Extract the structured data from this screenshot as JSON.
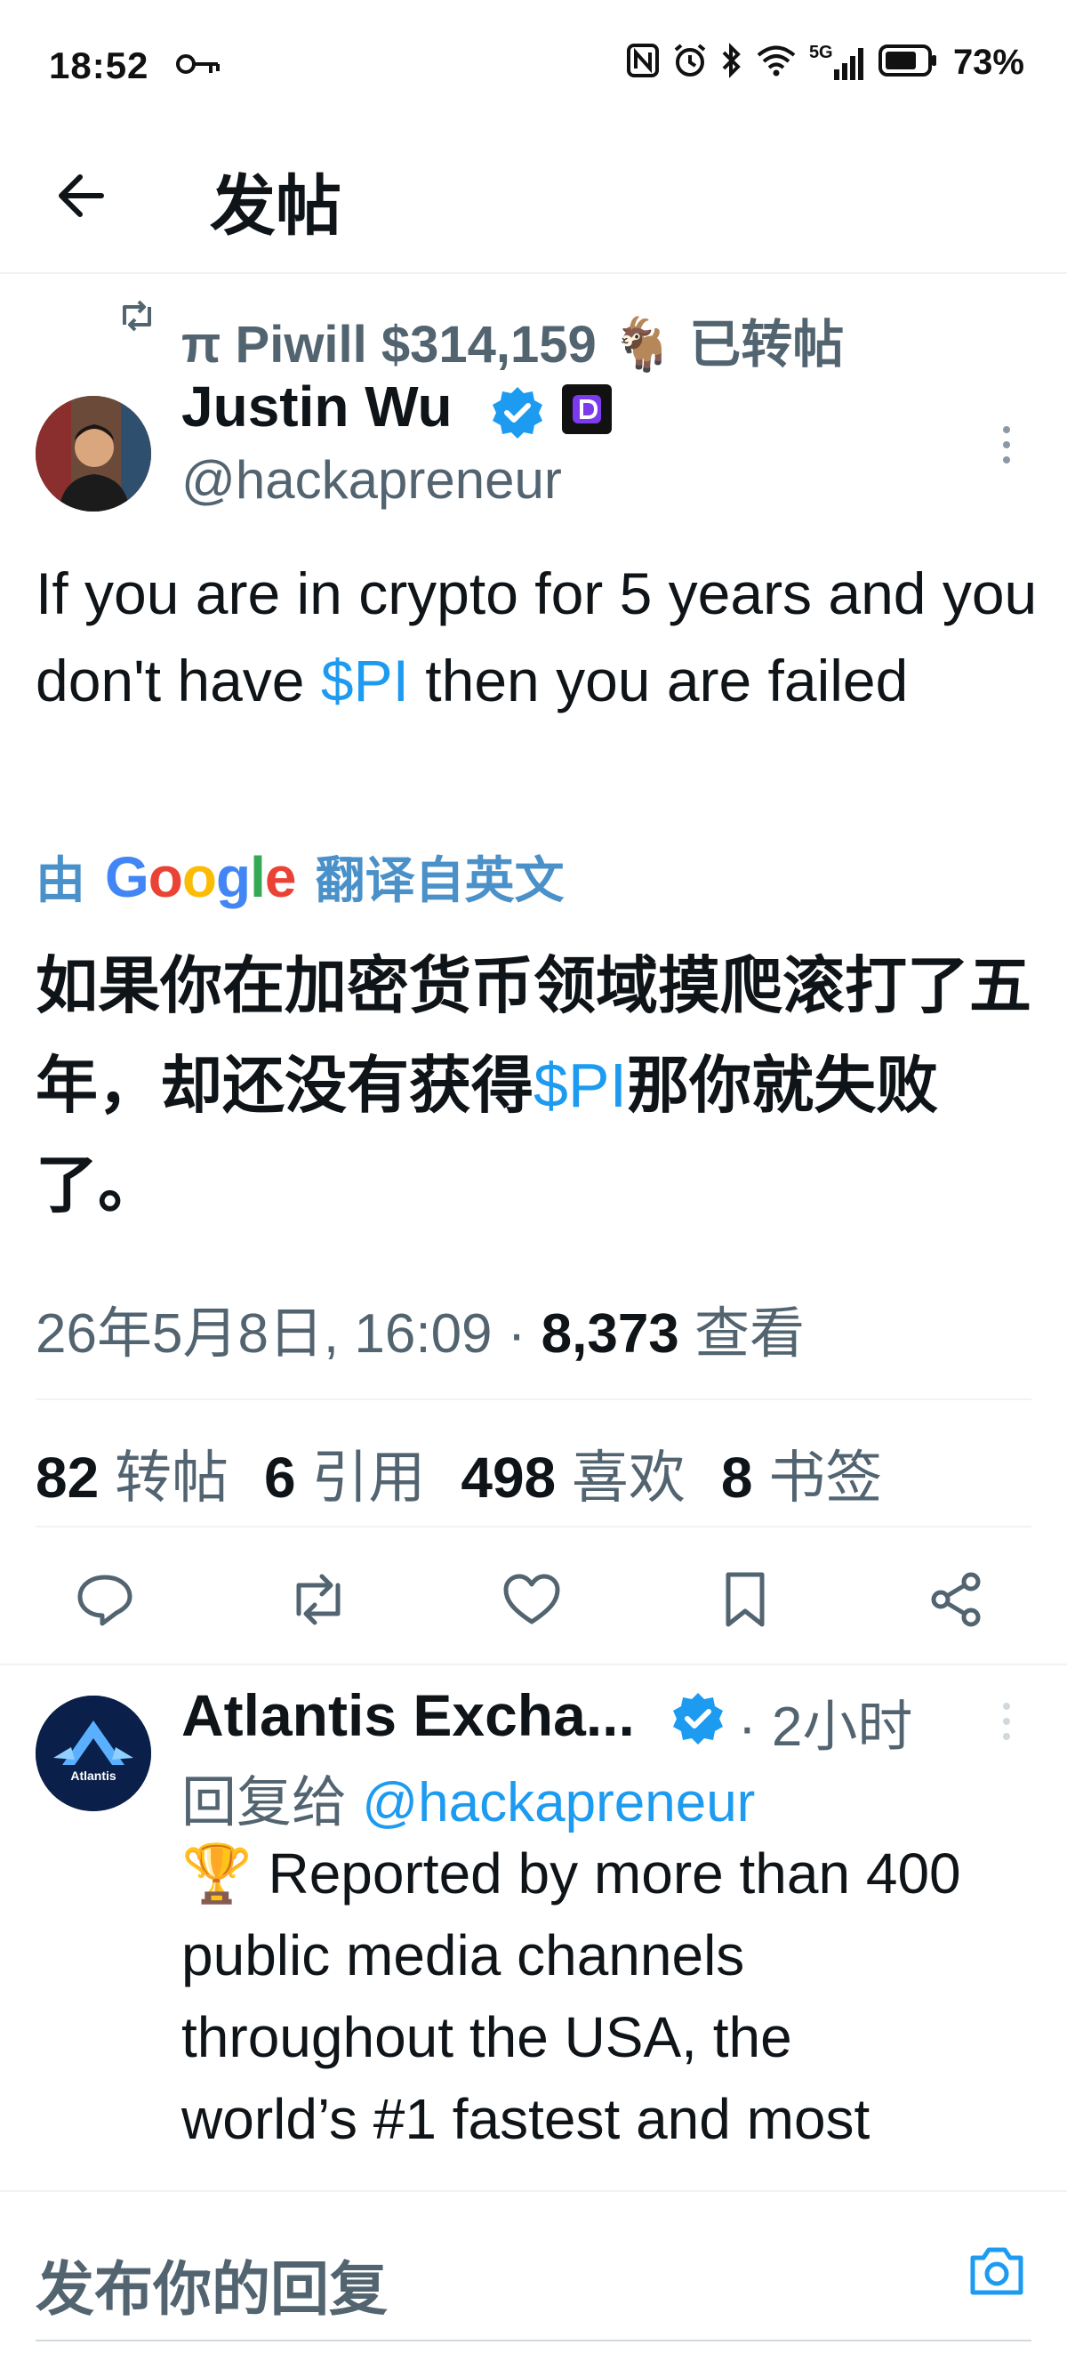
{
  "status_bar": {
    "time": "18:52",
    "battery_pct": "73%",
    "net_label": "5G"
  },
  "header": {
    "title": "发帖"
  },
  "retweet": {
    "text": "π Piwill $314,159 🐐 已转帖"
  },
  "tweet": {
    "author_name": "Justin Wu",
    "handle": "@hackapreneur",
    "text_part1": "If you are in crypto for 5 years and you don't have ",
    "cashtag": "$PI",
    "text_part2": " then you are failed",
    "translate_prefix": "由",
    "translate_brand": "Google",
    "translate_suffix": "翻译自英文",
    "translated_part1": "如果你在加密货币领域摸爬滚打了五年，却还没有获得",
    "translated_cashtag": "$PI",
    "translated_part2": "那你就失败了。",
    "timestamp": "26年5月8日, 16:09 · ",
    "views_count": "8,373",
    "views_label": " 查看"
  },
  "stats": {
    "reposts_count": "82",
    "reposts_label": " 转帖",
    "quotes_count": "6",
    "quotes_label": "引用",
    "likes_count": "498",
    "likes_label": " 喜欢",
    "bookmarks_count": "8",
    "bookmarks_label": " 书签"
  },
  "reply": {
    "author_name": "Atlantis Excha...",
    "time": "· 2小时",
    "replying_to_label": "回复给 ",
    "replying_to_handle": "@hackapreneur",
    "text": "🏆 Reported by more than 400 public media channels throughout the USA, the world’s #1 fastest and most",
    "avatar_label": "Atlantis"
  },
  "compose": {
    "placeholder": "发布你的回复"
  },
  "colors": {
    "accent": "#1d9bf0",
    "secondary_text": "#536471",
    "verified": "#1d9bf0",
    "translate_link": "#4a90c9"
  }
}
